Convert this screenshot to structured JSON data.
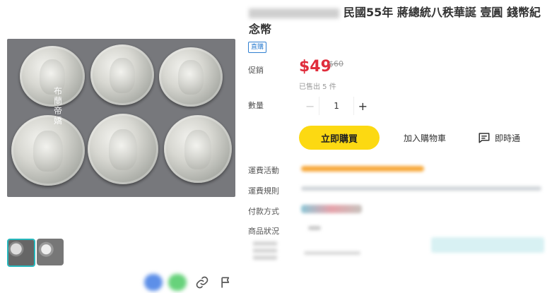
{
  "product": {
    "title": "民國55年 蔣總統八秩華誕 壹圓 錢幣紀念幣",
    "badge": "直購",
    "watermark": "布蘭帝嬌"
  },
  "labels": {
    "promo": "促銷",
    "quantity": "數量",
    "shipping_event": "運費活動",
    "shipping_rule": "運費規則",
    "payment": "付款方式",
    "condition": "商品狀況"
  },
  "pricing": {
    "price": "$49",
    "original_price": "$60",
    "sold": "已售出 5 件"
  },
  "quantity": {
    "value": "1",
    "minus": "−",
    "plus": "+"
  },
  "actions": {
    "buy_now": "立即購買",
    "add_to_cart": "加入購物車",
    "chat": "即時通"
  },
  "icons": [
    "chat-icon",
    "link-icon",
    "flag-icon"
  ],
  "colors": {
    "price": "#e02d3c",
    "buy_button": "#fcd912",
    "badge": "#2f7fd1",
    "thumb_border": "#26b7bc"
  }
}
